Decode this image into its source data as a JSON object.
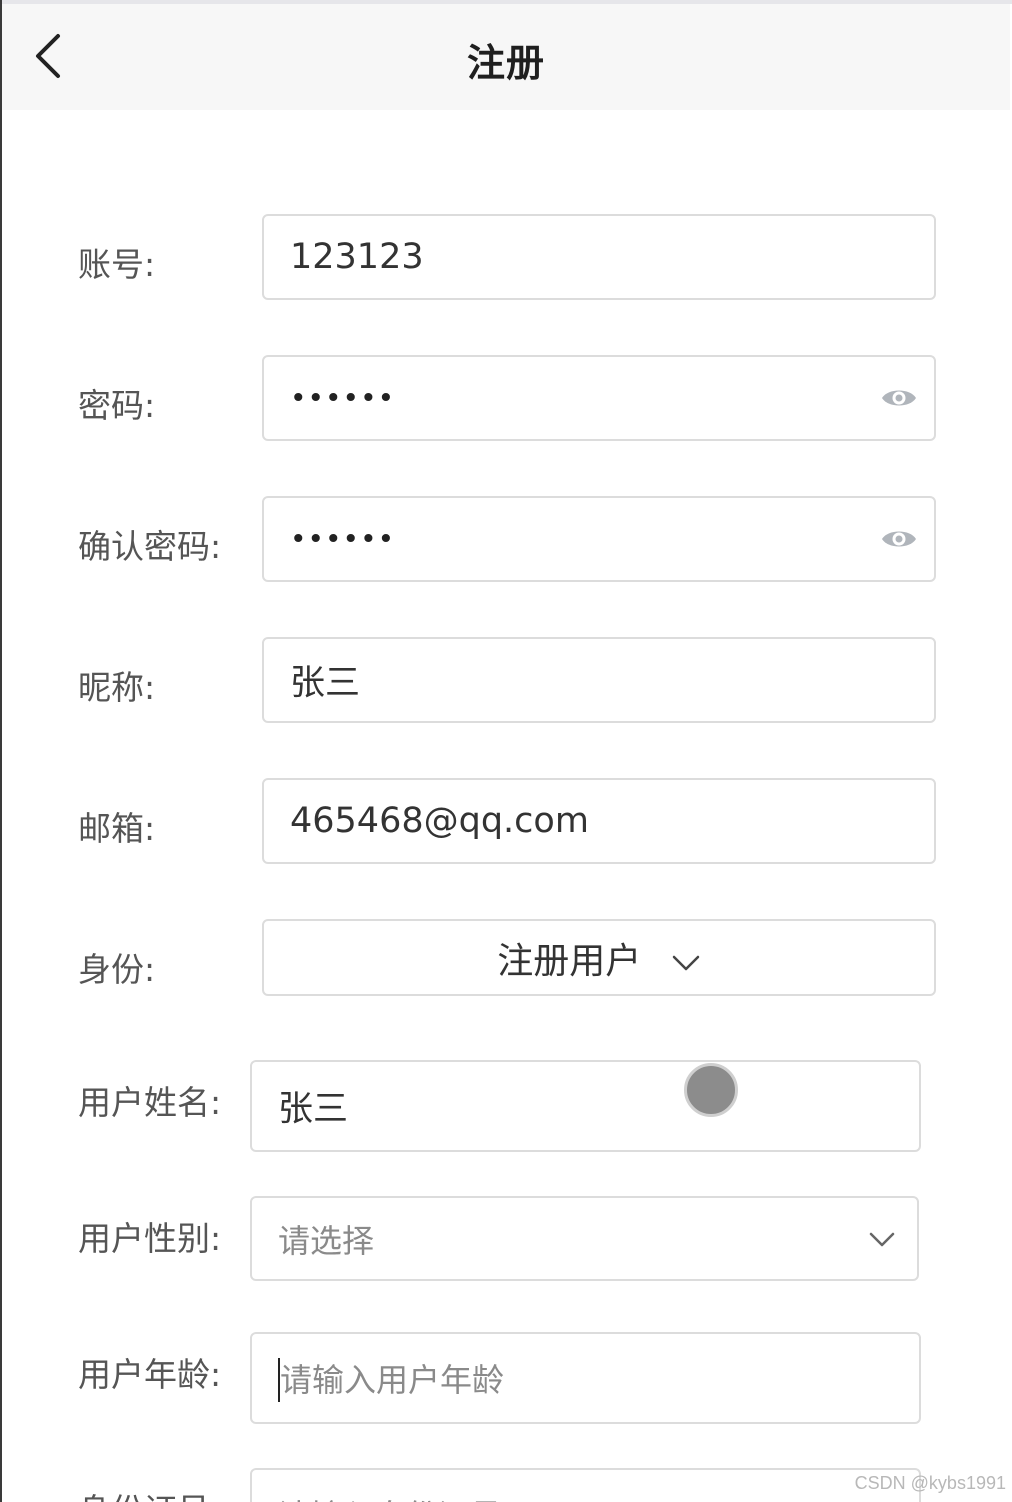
{
  "nav": {
    "title": "注册",
    "back_icon": "chevron-left-icon"
  },
  "form": {
    "account": {
      "label": "账号:",
      "value": "123123"
    },
    "password": {
      "label": "密码:",
      "value": "••••••",
      "toggle_icon": "eye-icon"
    },
    "confirm_password": {
      "label": "确认密码:",
      "value": "••••••",
      "toggle_icon": "eye-icon"
    },
    "nickname": {
      "label": "昵称:",
      "value": "张三"
    },
    "email": {
      "label": "邮箱:",
      "value": "465468@qq.com"
    },
    "identity": {
      "label": "身份:",
      "value": "注册用户",
      "icon": "chevron-down-icon"
    },
    "real_name": {
      "label": "用户姓名:",
      "value": "张三"
    },
    "gender": {
      "label": "用户性别:",
      "placeholder": "请选择",
      "icon": "chevron-down-icon"
    },
    "age": {
      "label": "用户年龄:",
      "placeholder": "请输入用户年龄"
    },
    "id_number": {
      "label": "身份证号:",
      "placeholder": "请输入身份证号"
    }
  },
  "watermark": "CSDN @kybs1991",
  "colors": {
    "nav_background": "#f7f7f7",
    "input_border": "#dcdcdc",
    "label_text": "#555555",
    "icon_gray": "#b0b5bb"
  }
}
